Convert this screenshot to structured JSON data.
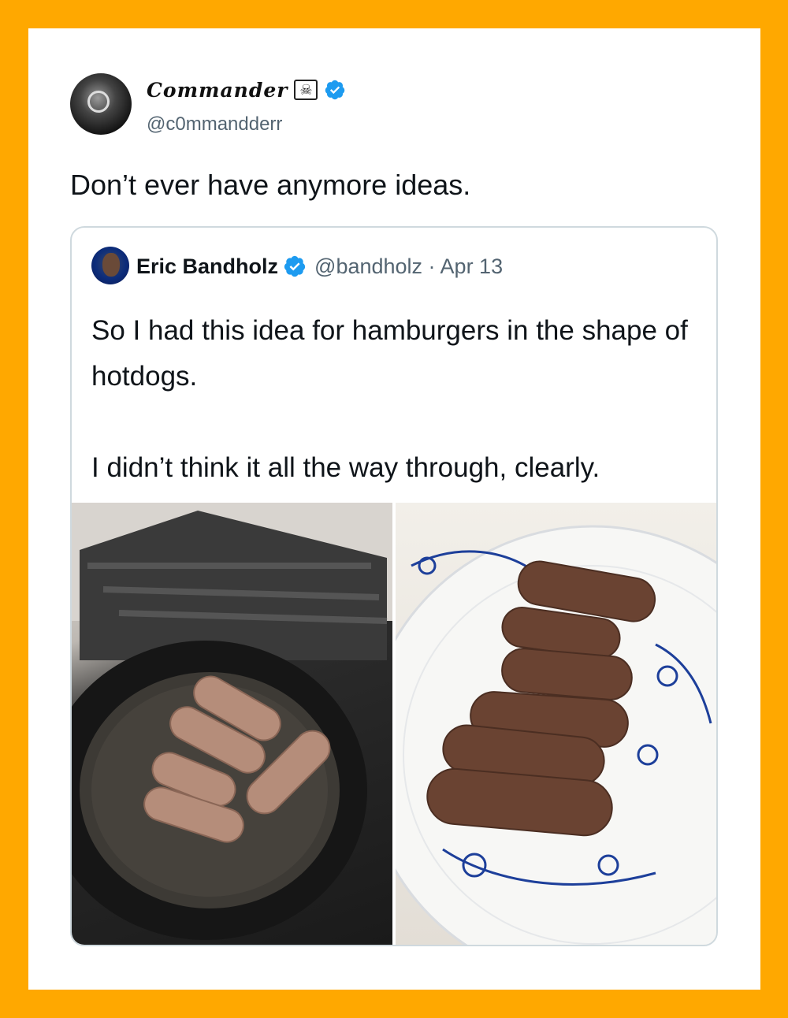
{
  "tweet": {
    "display_name": "Commander",
    "handle": "@c0mmandderr",
    "text": "Don’t ever have anymore ideas.",
    "name_icons": [
      "pirate-flag-icon",
      "verified-icon"
    ]
  },
  "quoted_tweet": {
    "display_name": "Eric Bandholz",
    "meta": "@bandholz · Apr 13",
    "lines": [
      "So I had this idea for hamburgers in the shape of hotdogs.",
      "I didn’t think it all the way through, clearly."
    ],
    "photos": [
      "pan-photo",
      "plate-photo"
    ]
  },
  "colors": {
    "frame": "#FFA800",
    "verified": "#1D9BF0",
    "secondary_text": "#536471",
    "border": "#CFD9DE"
  }
}
